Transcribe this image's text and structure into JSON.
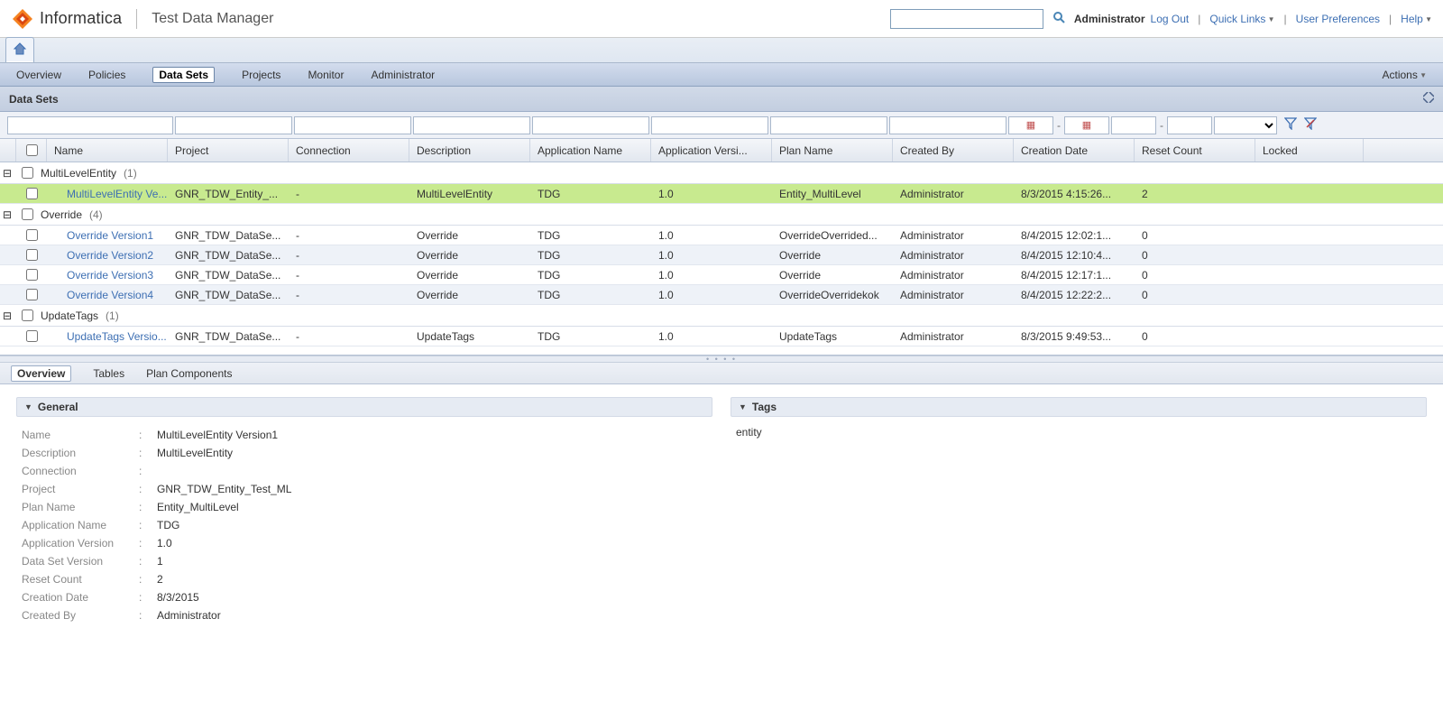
{
  "header": {
    "brand": "Informatica",
    "app_title": "Test Data Manager",
    "user": "Administrator",
    "logout_label": "Log Out",
    "quick_links_label": "Quick Links",
    "user_prefs_label": "User Preferences",
    "help_label": "Help"
  },
  "nav": {
    "items": [
      "Overview",
      "Policies",
      "Data Sets",
      "Projects",
      "Monitor",
      "Administrator"
    ],
    "actions_label": "Actions"
  },
  "panel": {
    "title": "Data Sets"
  },
  "columns": {
    "name": "Name",
    "project": "Project",
    "connection": "Connection",
    "description": "Description",
    "app_name": "Application Name",
    "app_version": "Application Versi...",
    "plan_name": "Plan Name",
    "created_by": "Created By",
    "creation_date": "Creation Date",
    "reset_count": "Reset Count",
    "locked": "Locked"
  },
  "groups": [
    {
      "label": "MultiLevelEntity",
      "count": "1",
      "rows": [
        {
          "name": "MultiLevelEntity Ve...",
          "project": "GNR_TDW_Entity_...",
          "connection": "-",
          "description": "MultiLevelEntity",
          "app_name": "TDG",
          "app_version": "1.0",
          "plan_name": "Entity_MultiLevel",
          "created_by": "Administrator",
          "creation_date": "8/3/2015 4:15:26...",
          "reset_count": "2",
          "selected": true
        }
      ]
    },
    {
      "label": "Override",
      "count": "4",
      "rows": [
        {
          "name": "Override Version1",
          "project": "GNR_TDW_DataSe...",
          "connection": "-",
          "description": "Override",
          "app_name": "TDG",
          "app_version": "1.0",
          "plan_name": "OverrideOverrided...",
          "created_by": "Administrator",
          "creation_date": "8/4/2015 12:02:1...",
          "reset_count": "0"
        },
        {
          "name": "Override Version2",
          "project": "GNR_TDW_DataSe...",
          "connection": "-",
          "description": "Override",
          "app_name": "TDG",
          "app_version": "1.0",
          "plan_name": "Override",
          "created_by": "Administrator",
          "creation_date": "8/4/2015 12:10:4...",
          "reset_count": "0",
          "alt": true
        },
        {
          "name": "Override Version3",
          "project": "GNR_TDW_DataSe...",
          "connection": "-",
          "description": "Override",
          "app_name": "TDG",
          "app_version": "1.0",
          "plan_name": "Override",
          "created_by": "Administrator",
          "creation_date": "8/4/2015 12:17:1...",
          "reset_count": "0"
        },
        {
          "name": "Override Version4",
          "project": "GNR_TDW_DataSe...",
          "connection": "-",
          "description": "Override",
          "app_name": "TDG",
          "app_version": "1.0",
          "plan_name": "OverrideOverridekok",
          "created_by": "Administrator",
          "creation_date": "8/4/2015 12:22:2...",
          "reset_count": "0",
          "alt": true
        }
      ]
    },
    {
      "label": "UpdateTags",
      "count": "1",
      "rows": [
        {
          "name": "UpdateTags Versio...",
          "project": "GNR_TDW_DataSe...",
          "connection": "-",
          "description": "UpdateTags",
          "app_name": "TDG",
          "app_version": "1.0",
          "plan_name": "UpdateTags",
          "created_by": "Administrator",
          "creation_date": "8/3/2015 9:49:53...",
          "reset_count": "0"
        }
      ]
    }
  ],
  "detail": {
    "tabs": [
      "Overview",
      "Tables",
      "Plan Components"
    ],
    "general_title": "General",
    "tags_title": "Tags",
    "tags_value": "entity",
    "kv": [
      {
        "k": "Name",
        "v": "MultiLevelEntity Version1"
      },
      {
        "k": "Description",
        "v": "MultiLevelEntity"
      },
      {
        "k": "Connection",
        "v": ""
      },
      {
        "k": "Project",
        "v": "GNR_TDW_Entity_Test_ML"
      },
      {
        "k": "Plan Name",
        "v": "Entity_MultiLevel"
      },
      {
        "k": "Application Name",
        "v": "TDG"
      },
      {
        "k": "Application Version",
        "v": "1.0"
      },
      {
        "k": "Data Set Version",
        "v": "1"
      },
      {
        "k": "Reset Count",
        "v": "2"
      },
      {
        "k": "Creation Date",
        "v": "8/3/2015"
      },
      {
        "k": "Created By",
        "v": "Administrator"
      }
    ]
  }
}
